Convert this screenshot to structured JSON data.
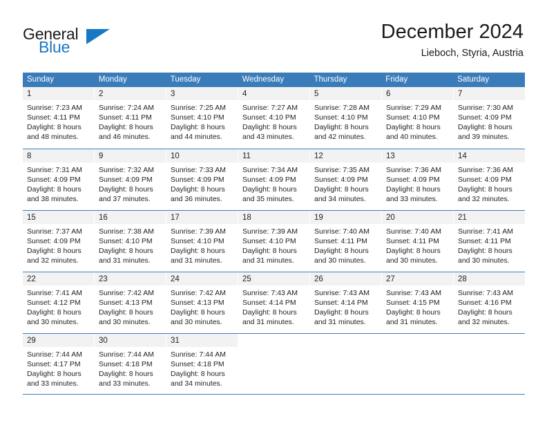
{
  "brand": {
    "word_one": "General",
    "word_two": "Blue",
    "mark": "triangle-logo"
  },
  "header": {
    "title": "December 2024",
    "location": "Lieboch, Styria, Austria"
  },
  "colors": {
    "header_blue": "#3a7cba",
    "brand_blue": "#1878c4",
    "day_band": "#f2f2f2",
    "text": "#222222"
  },
  "calendar": {
    "weekdays": [
      "Sunday",
      "Monday",
      "Tuesday",
      "Wednesday",
      "Thursday",
      "Friday",
      "Saturday"
    ],
    "weeks": [
      [
        {
          "day": "1",
          "sunrise": "Sunrise: 7:23 AM",
          "sunset": "Sunset: 4:11 PM",
          "daylight1": "Daylight: 8 hours",
          "daylight2": "and 48 minutes."
        },
        {
          "day": "2",
          "sunrise": "Sunrise: 7:24 AM",
          "sunset": "Sunset: 4:11 PM",
          "daylight1": "Daylight: 8 hours",
          "daylight2": "and 46 minutes."
        },
        {
          "day": "3",
          "sunrise": "Sunrise: 7:25 AM",
          "sunset": "Sunset: 4:10 PM",
          "daylight1": "Daylight: 8 hours",
          "daylight2": "and 44 minutes."
        },
        {
          "day": "4",
          "sunrise": "Sunrise: 7:27 AM",
          "sunset": "Sunset: 4:10 PM",
          "daylight1": "Daylight: 8 hours",
          "daylight2": "and 43 minutes."
        },
        {
          "day": "5",
          "sunrise": "Sunrise: 7:28 AM",
          "sunset": "Sunset: 4:10 PM",
          "daylight1": "Daylight: 8 hours",
          "daylight2": "and 42 minutes."
        },
        {
          "day": "6",
          "sunrise": "Sunrise: 7:29 AM",
          "sunset": "Sunset: 4:10 PM",
          "daylight1": "Daylight: 8 hours",
          "daylight2": "and 40 minutes."
        },
        {
          "day": "7",
          "sunrise": "Sunrise: 7:30 AM",
          "sunset": "Sunset: 4:09 PM",
          "daylight1": "Daylight: 8 hours",
          "daylight2": "and 39 minutes."
        }
      ],
      [
        {
          "day": "8",
          "sunrise": "Sunrise: 7:31 AM",
          "sunset": "Sunset: 4:09 PM",
          "daylight1": "Daylight: 8 hours",
          "daylight2": "and 38 minutes."
        },
        {
          "day": "9",
          "sunrise": "Sunrise: 7:32 AM",
          "sunset": "Sunset: 4:09 PM",
          "daylight1": "Daylight: 8 hours",
          "daylight2": "and 37 minutes."
        },
        {
          "day": "10",
          "sunrise": "Sunrise: 7:33 AM",
          "sunset": "Sunset: 4:09 PM",
          "daylight1": "Daylight: 8 hours",
          "daylight2": "and 36 minutes."
        },
        {
          "day": "11",
          "sunrise": "Sunrise: 7:34 AM",
          "sunset": "Sunset: 4:09 PM",
          "daylight1": "Daylight: 8 hours",
          "daylight2": "and 35 minutes."
        },
        {
          "day": "12",
          "sunrise": "Sunrise: 7:35 AM",
          "sunset": "Sunset: 4:09 PM",
          "daylight1": "Daylight: 8 hours",
          "daylight2": "and 34 minutes."
        },
        {
          "day": "13",
          "sunrise": "Sunrise: 7:36 AM",
          "sunset": "Sunset: 4:09 PM",
          "daylight1": "Daylight: 8 hours",
          "daylight2": "and 33 minutes."
        },
        {
          "day": "14",
          "sunrise": "Sunrise: 7:36 AM",
          "sunset": "Sunset: 4:09 PM",
          "daylight1": "Daylight: 8 hours",
          "daylight2": "and 32 minutes."
        }
      ],
      [
        {
          "day": "15",
          "sunrise": "Sunrise: 7:37 AM",
          "sunset": "Sunset: 4:09 PM",
          "daylight1": "Daylight: 8 hours",
          "daylight2": "and 32 minutes."
        },
        {
          "day": "16",
          "sunrise": "Sunrise: 7:38 AM",
          "sunset": "Sunset: 4:10 PM",
          "daylight1": "Daylight: 8 hours",
          "daylight2": "and 31 minutes."
        },
        {
          "day": "17",
          "sunrise": "Sunrise: 7:39 AM",
          "sunset": "Sunset: 4:10 PM",
          "daylight1": "Daylight: 8 hours",
          "daylight2": "and 31 minutes."
        },
        {
          "day": "18",
          "sunrise": "Sunrise: 7:39 AM",
          "sunset": "Sunset: 4:10 PM",
          "daylight1": "Daylight: 8 hours",
          "daylight2": "and 31 minutes."
        },
        {
          "day": "19",
          "sunrise": "Sunrise: 7:40 AM",
          "sunset": "Sunset: 4:11 PM",
          "daylight1": "Daylight: 8 hours",
          "daylight2": "and 30 minutes."
        },
        {
          "day": "20",
          "sunrise": "Sunrise: 7:40 AM",
          "sunset": "Sunset: 4:11 PM",
          "daylight1": "Daylight: 8 hours",
          "daylight2": "and 30 minutes."
        },
        {
          "day": "21",
          "sunrise": "Sunrise: 7:41 AM",
          "sunset": "Sunset: 4:11 PM",
          "daylight1": "Daylight: 8 hours",
          "daylight2": "and 30 minutes."
        }
      ],
      [
        {
          "day": "22",
          "sunrise": "Sunrise: 7:41 AM",
          "sunset": "Sunset: 4:12 PM",
          "daylight1": "Daylight: 8 hours",
          "daylight2": "and 30 minutes."
        },
        {
          "day": "23",
          "sunrise": "Sunrise: 7:42 AM",
          "sunset": "Sunset: 4:13 PM",
          "daylight1": "Daylight: 8 hours",
          "daylight2": "and 30 minutes."
        },
        {
          "day": "24",
          "sunrise": "Sunrise: 7:42 AM",
          "sunset": "Sunset: 4:13 PM",
          "daylight1": "Daylight: 8 hours",
          "daylight2": "and 30 minutes."
        },
        {
          "day": "25",
          "sunrise": "Sunrise: 7:43 AM",
          "sunset": "Sunset: 4:14 PM",
          "daylight1": "Daylight: 8 hours",
          "daylight2": "and 31 minutes."
        },
        {
          "day": "26",
          "sunrise": "Sunrise: 7:43 AM",
          "sunset": "Sunset: 4:14 PM",
          "daylight1": "Daylight: 8 hours",
          "daylight2": "and 31 minutes."
        },
        {
          "day": "27",
          "sunrise": "Sunrise: 7:43 AM",
          "sunset": "Sunset: 4:15 PM",
          "daylight1": "Daylight: 8 hours",
          "daylight2": "and 31 minutes."
        },
        {
          "day": "28",
          "sunrise": "Sunrise: 7:43 AM",
          "sunset": "Sunset: 4:16 PM",
          "daylight1": "Daylight: 8 hours",
          "daylight2": "and 32 minutes."
        }
      ],
      [
        {
          "day": "29",
          "sunrise": "Sunrise: 7:44 AM",
          "sunset": "Sunset: 4:17 PM",
          "daylight1": "Daylight: 8 hours",
          "daylight2": "and 33 minutes."
        },
        {
          "day": "30",
          "sunrise": "Sunrise: 7:44 AM",
          "sunset": "Sunset: 4:18 PM",
          "daylight1": "Daylight: 8 hours",
          "daylight2": "and 33 minutes."
        },
        {
          "day": "31",
          "sunrise": "Sunrise: 7:44 AM",
          "sunset": "Sunset: 4:18 PM",
          "daylight1": "Daylight: 8 hours",
          "daylight2": "and 34 minutes."
        },
        {
          "day": "",
          "sunrise": "",
          "sunset": "",
          "daylight1": "",
          "daylight2": ""
        },
        {
          "day": "",
          "sunrise": "",
          "sunset": "",
          "daylight1": "",
          "daylight2": ""
        },
        {
          "day": "",
          "sunrise": "",
          "sunset": "",
          "daylight1": "",
          "daylight2": ""
        },
        {
          "day": "",
          "sunrise": "",
          "sunset": "",
          "daylight1": "",
          "daylight2": ""
        }
      ]
    ]
  }
}
